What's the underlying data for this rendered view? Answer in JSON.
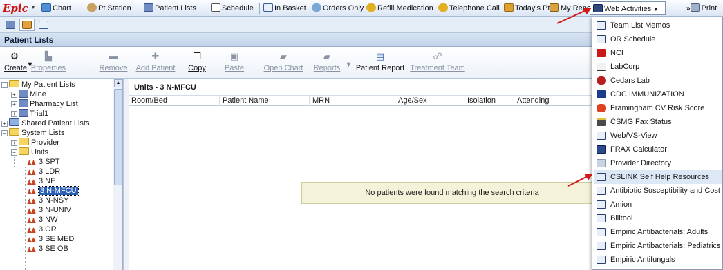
{
  "toolbar": {
    "logo": "Epic",
    "items": [
      {
        "label": "Chart",
        "icon": "chart-icon"
      },
      {
        "label": "Pt Station",
        "icon": "pt-station-icon"
      },
      {
        "label": "Patient Lists",
        "icon": "patient-lists-icon"
      },
      {
        "label": "Schedule",
        "icon": "schedule-icon"
      },
      {
        "label": "In Basket",
        "icon": "in-basket-icon"
      },
      {
        "label": "Orders Only",
        "icon": "orders-icon"
      },
      {
        "label": "Refill Medication",
        "icon": "refill-icon"
      },
      {
        "label": "Telephone Call",
        "icon": "telephone-icon"
      },
      {
        "label": "Today's Pts",
        "icon": "todays-pts-icon"
      },
      {
        "label": "My Reports",
        "icon": "reports-icon"
      }
    ],
    "web_activities": "Web Activities",
    "print": "Print"
  },
  "section_title": "Patient Lists",
  "activities": {
    "create": "Create",
    "properties": "Properties",
    "remove": "Remove",
    "add_patient": "Add Patient",
    "copy": "Copy",
    "paste": "Paste",
    "open_chart": "Open Chart",
    "reports": "Reports",
    "patient_report": "Patient Report",
    "treatment_team": "Treatment Team"
  },
  "tree": {
    "nodes": [
      {
        "label": "My Patient Lists",
        "kind": "folder"
      },
      {
        "label": "Mine",
        "kind": "list"
      },
      {
        "label": "Pharmacy List",
        "kind": "list"
      },
      {
        "label": "Trial1",
        "kind": "list"
      },
      {
        "label": "Shared Patient Lists",
        "kind": "folder"
      },
      {
        "label": "System Lists",
        "kind": "folder"
      },
      {
        "label": "Provider",
        "kind": "folder"
      },
      {
        "label": "Units",
        "kind": "folder"
      },
      {
        "label": "3 SPT",
        "kind": "unit"
      },
      {
        "label": "3 LDR",
        "kind": "unit"
      },
      {
        "label": "3 NE",
        "kind": "unit"
      },
      {
        "label": "3 N-MFCU",
        "kind": "unit",
        "selected": true
      },
      {
        "label": "3 N-NSY",
        "kind": "unit"
      },
      {
        "label": "3 N-UNIV",
        "kind": "unit"
      },
      {
        "label": "3 NW",
        "kind": "unit"
      },
      {
        "label": "3 OR",
        "kind": "unit"
      },
      {
        "label": "3 SE MED",
        "kind": "unit"
      },
      {
        "label": "3 SE OB",
        "kind": "unit"
      }
    ]
  },
  "main": {
    "list_title": "Units - 3 N-MFCU",
    "columns": [
      "Room/Bed",
      "Patient Name",
      "MRN",
      "Age/Sex",
      "Isolation",
      "Attending"
    ],
    "empty_message": "No patients were found matching the search criteria"
  },
  "menu": {
    "items": [
      {
        "label": "Team List Memos",
        "icon": "web-page-icon"
      },
      {
        "label": "OR Schedule",
        "icon": "web-page-icon"
      },
      {
        "label": "NCI",
        "icon": "nci-logo-icon"
      },
      {
        "label": "LabCorp",
        "icon": "labcorp-logo-icon"
      },
      {
        "label": "Cedars Lab",
        "icon": "cedars-logo-icon"
      },
      {
        "label": "CDC IMMUNIZATION",
        "icon": "cdc-logo-icon"
      },
      {
        "label": "Framingham CV Risk Score",
        "icon": "heart-icon"
      },
      {
        "label": "CSMG Fax Status",
        "icon": "fax-icon"
      },
      {
        "label": "Web/VS-View",
        "icon": "web-page-icon"
      },
      {
        "label": "FRAX Calculator",
        "icon": "calculator-icon"
      },
      {
        "label": "Provider Directory",
        "icon": "directory-icon"
      },
      {
        "label": "CSLINK Self Help Resources",
        "icon": "web-page-icon"
      },
      {
        "label": "Antibiotic Susceptibility and Cost",
        "icon": "web-page-icon"
      },
      {
        "label": "Amion",
        "icon": "web-page-icon"
      },
      {
        "label": "Bilitool",
        "icon": "web-page-icon"
      },
      {
        "label": "Empiric Antibacterials: Adults",
        "icon": "web-page-icon"
      },
      {
        "label": "Empiric Antibacterials: Pediatrics",
        "icon": "web-page-icon"
      },
      {
        "label": "Empiric Antifungals",
        "icon": "web-page-icon"
      }
    ]
  },
  "colors": {
    "accent": "#2a5fb8",
    "annotation_arrow": "#d01818",
    "logo": "#d01010"
  }
}
